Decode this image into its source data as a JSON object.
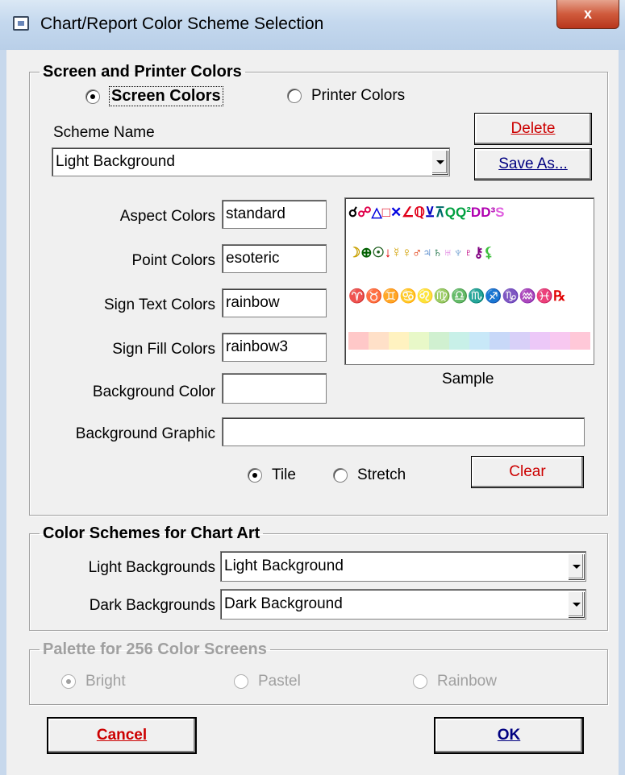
{
  "window": {
    "title": "Chart/Report Color Scheme Selection",
    "close_label": "x"
  },
  "screen_printer_group": {
    "legend": "Screen and Printer Colors",
    "radio_screen": "Screen Colors",
    "radio_printer": "Printer Colors",
    "selected": "screen",
    "scheme_name_label": "Scheme Name",
    "scheme_name_value": "Light Background",
    "delete_label": "Delete",
    "save_as_label": "Save As...",
    "aspect_label": "Aspect Colors",
    "aspect_value": "standard",
    "point_label": "Point Colors",
    "point_value": "esoteric",
    "sign_text_label": "Sign Text Colors",
    "sign_text_value": "rainbow",
    "sign_fill_label": "Sign Fill Colors",
    "sign_fill_value": "rainbow3",
    "background_color_label": "Background Color",
    "background_color_value": "",
    "background_graphic_label": "Background Graphic",
    "background_graphic_value": "",
    "tile_label": "Tile",
    "stretch_label": "Stretch",
    "graphic_mode": "tile",
    "clear_label": "Clear",
    "sample_caption": "Sample"
  },
  "sample": {
    "rows": [
      [
        {
          "g": "☌",
          "c": "#000000"
        },
        {
          "g": "☍",
          "c": "#e0004a"
        },
        {
          "g": "△",
          "c": "#0000e0"
        },
        {
          "g": "□",
          "c": "#e0001a"
        },
        {
          "g": "✕",
          "c": "#0000e0"
        },
        {
          "g": "∠",
          "c": "#e0001a"
        },
        {
          "g": "ℚ",
          "c": "#e0001a"
        },
        {
          "g": "⊻",
          "c": "#0000c0"
        },
        {
          "g": "⊼",
          "c": "#006a6a"
        },
        {
          "g": "Q",
          "c": "#00a040"
        },
        {
          "g": "Q²",
          "c": "#00a040"
        },
        {
          "g": "D",
          "c": "#b000b0"
        },
        {
          "g": "D³",
          "c": "#b000b0"
        },
        {
          "g": "S",
          "c": "#e060e0"
        }
      ],
      [
        {
          "g": "☽",
          "c": "#c8a000"
        },
        {
          "g": "⊕",
          "c": "#006000"
        },
        {
          "g": "☉",
          "c": "#206020"
        },
        {
          "g": "↓",
          "c": "#e00000"
        },
        {
          "g": "☿",
          "c": "#d0a000"
        },
        {
          "g": "♀",
          "c": "#d0a000"
        },
        {
          "g": "♂",
          "c": "#e03000"
        },
        {
          "g": "♃",
          "c": "#3070c0"
        },
        {
          "g": "♄",
          "c": "#006030"
        },
        {
          "g": "♅",
          "c": "#e080e0"
        },
        {
          "g": "♆",
          "c": "#70a0d0"
        },
        {
          "g": "♇",
          "c": "#c00080"
        },
        {
          "g": "⚷",
          "c": "#800080"
        },
        {
          "g": "⚸",
          "c": "#40c040"
        }
      ],
      [
        {
          "g": "♈",
          "c": "#e00000"
        },
        {
          "g": "♉",
          "c": "#e0a000"
        },
        {
          "g": "♊",
          "c": "#c0a000"
        },
        {
          "g": "♋",
          "c": "#008000"
        },
        {
          "g": "♌",
          "c": "#008000"
        },
        {
          "g": "♍",
          "c": "#40c0c0"
        },
        {
          "g": "♎",
          "c": "#40a0c0"
        },
        {
          "g": "♏",
          "c": "#1010c0"
        },
        {
          "g": "♐",
          "c": "#2040c0"
        },
        {
          "g": "♑",
          "c": "#8000c0"
        },
        {
          "g": "♒",
          "c": "#e080e0"
        },
        {
          "g": "♓",
          "c": "#e000c0"
        },
        {
          "g": "℞",
          "c": "#e00000"
        }
      ]
    ],
    "fills": [
      "#ffc8c8",
      "#ffe0c8",
      "#fff2c0",
      "#e8f8c8",
      "#d0f0d0",
      "#c8f0e8",
      "#c8e8f8",
      "#c8d8f8",
      "#d8d0f8",
      "#ecc8f8",
      "#f8c8f0",
      "#ffc8d8"
    ]
  },
  "chart_art_group": {
    "legend": "Color Schemes for Chart Art",
    "light_label": "Light Backgrounds",
    "light_value": "Light Background",
    "dark_label": "Dark Backgrounds",
    "dark_value": "Dark Background"
  },
  "palette_group": {
    "legend": "Palette for 256 Color Screens",
    "bright": "Bright",
    "pastel": "Pastel",
    "rainbow": "Rainbow",
    "selected": "bright",
    "enabled": false
  },
  "footer": {
    "cancel_label": "Cancel",
    "ok_label": "OK"
  },
  "colors": {
    "accent_red": "#cc0000",
    "accent_blue": "#000080"
  }
}
